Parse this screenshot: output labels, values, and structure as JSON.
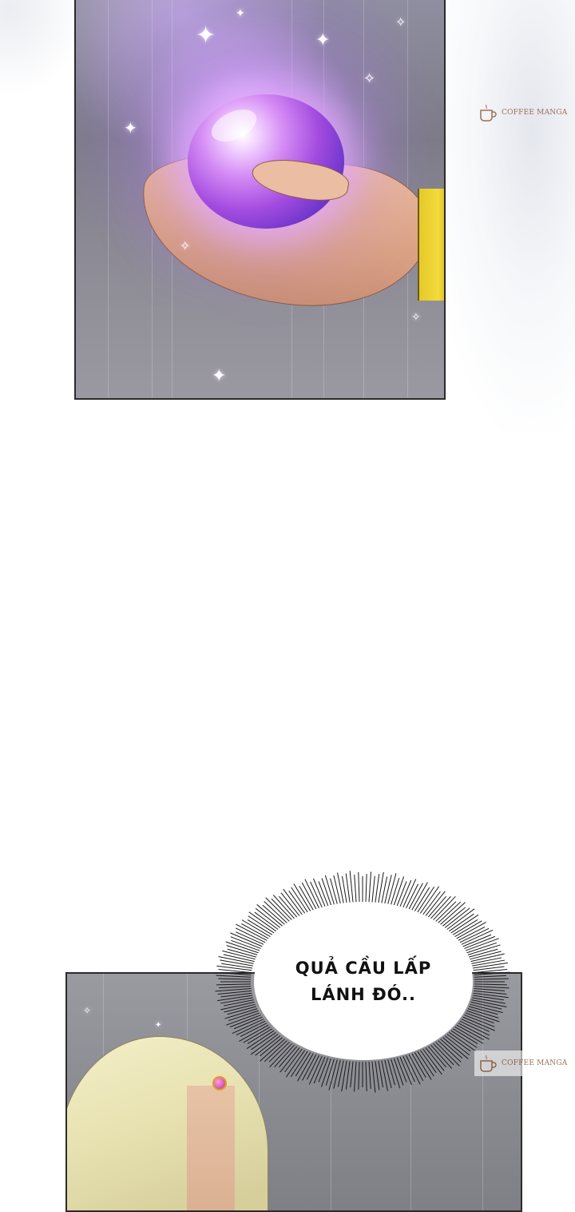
{
  "watermark": {
    "label": "COFFEE MANGA"
  },
  "speech_bubble": {
    "line1": "QUẢ CẦU LẤP",
    "line2": "LÁNH ĐÓ.."
  },
  "colors": {
    "orb_glow": "#d58cf4",
    "sky_gray": "#8b8b92",
    "sleeve_yellow": "#f2db3a",
    "hair_blonde": "#f3efc8"
  }
}
